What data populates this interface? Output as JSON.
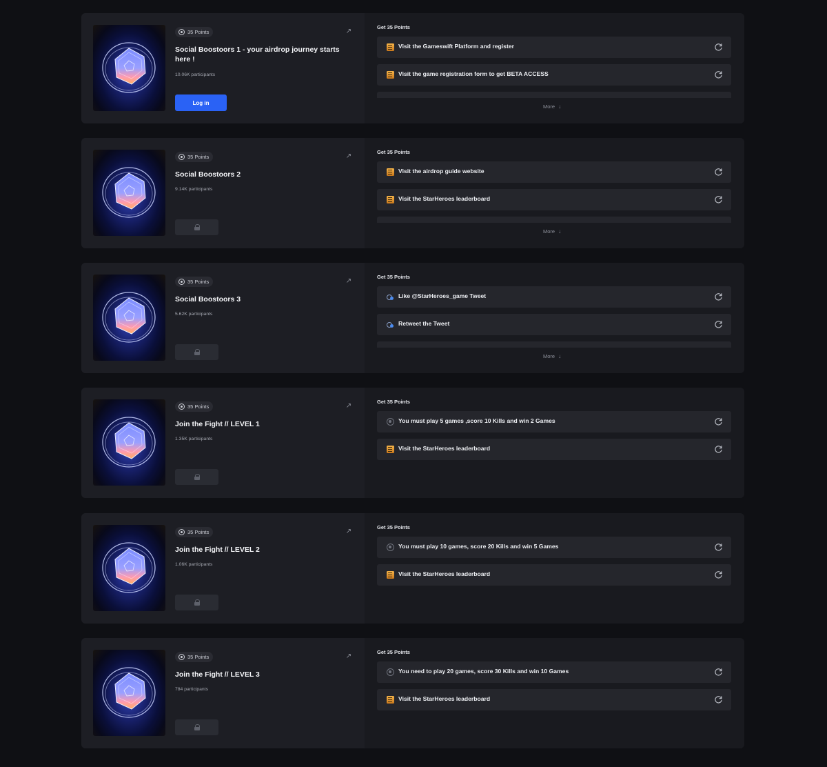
{
  "quests": [
    {
      "points_badge": "35 Points",
      "title": "Social Boostoors 1 - your airdrop journey starts here !",
      "participants": "10.06K participants",
      "action": "login",
      "login_label": "Log in",
      "get_points": "Get 35 Points",
      "more_label": "More",
      "tasks": [
        {
          "icon": "document-icon",
          "label": "Visit the Gameswift Platform and register"
        },
        {
          "icon": "document-icon",
          "label": "Visit the game registration form to get BETA ACCESS"
        },
        {
          "icon": "document-icon",
          "label": ""
        }
      ]
    },
    {
      "points_badge": "35 Points",
      "title": "Social Boostoors 2",
      "participants": "9.14K participants",
      "action": "locked",
      "get_points": "Get 35 Points",
      "more_label": "More",
      "tasks": [
        {
          "icon": "document-icon",
          "label": "Visit the airdrop guide website"
        },
        {
          "icon": "document-icon",
          "label": "Visit the StarHeroes leaderboard"
        },
        {
          "icon": "document-icon",
          "label": ""
        }
      ]
    },
    {
      "points_badge": "35 Points",
      "title": "Social Boostoors 3",
      "participants": "5.62K participants",
      "action": "locked",
      "get_points": "Get 35 Points",
      "more_label": "More",
      "tasks": [
        {
          "icon": "twitter-icon",
          "label": "Like @StarHeroes_game Tweet"
        },
        {
          "icon": "twitter-icon",
          "label": "Retweet the Tweet"
        },
        {
          "icon": "twitter-icon",
          "label": ""
        }
      ]
    },
    {
      "points_badge": "35 Points",
      "title": "Join the Fight // LEVEL 1",
      "participants": "1.35K participants",
      "action": "locked",
      "get_points": "Get 35 Points",
      "more_label": "",
      "tasks": [
        {
          "icon": "target-icon",
          "label": "You must play 5 games ,score 10 Kills and win 2 Games"
        },
        {
          "icon": "document-icon",
          "label": "Visit the StarHeroes leaderboard"
        }
      ]
    },
    {
      "points_badge": "35 Points",
      "title": "Join the Fight // LEVEL 2",
      "participants": "1.06K participants",
      "action": "locked",
      "get_points": "Get 35 Points",
      "more_label": "",
      "tasks": [
        {
          "icon": "target-icon",
          "label": "You must play 10 games, score 20 Kills and win 5 Games"
        },
        {
          "icon": "document-icon",
          "label": "Visit the StarHeroes leaderboard"
        }
      ]
    },
    {
      "points_badge": "35 Points",
      "title": "Join the Fight // LEVEL 3",
      "participants": "784 participants",
      "action": "locked",
      "get_points": "Get 35 Points",
      "more_label": "",
      "tasks": [
        {
          "icon": "target-icon",
          "label": "You need to play 20 games, score 30 Kills and win 10 Games"
        },
        {
          "icon": "document-icon",
          "label": "Visit the StarHeroes leaderboard"
        }
      ]
    }
  ],
  "colors": {
    "page_bg": "#0f1014",
    "card_bg": "#1b1c21",
    "task_bg": "#25262c",
    "accent_blue": "#2a62f5"
  }
}
